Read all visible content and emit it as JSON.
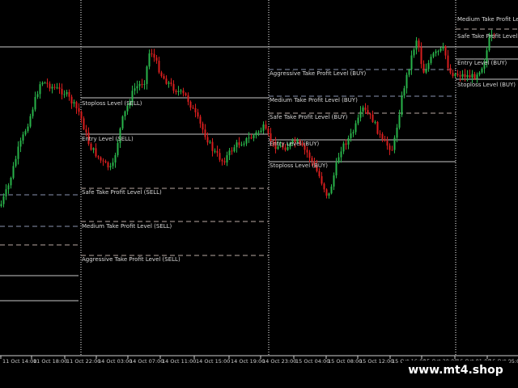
{
  "colors": {
    "background": "#000000",
    "bull_candle": "#29b34a",
    "bear_candle": "#d81e1e",
    "level_line": "#c8c8c8",
    "dashed_sell": "#b9a9a2",
    "dashed_buy": "#8a93b0",
    "period_separator": "#ffffff",
    "watermark_text": "#ffffff"
  },
  "levels_sell": [
    {
      "label": "Stoploss Level (SELL)"
    },
    {
      "label": "Entry Level (SELL)"
    },
    {
      "label": "Safe Take Profit Level (SELL)"
    },
    {
      "label": "Medium Take Profit Level (SELL)"
    },
    {
      "label": "Aggressive Take Profit Level (SELL)"
    }
  ],
  "levels_buy_1": [
    {
      "label": "Aggressive Take Profit Level (BUY)"
    },
    {
      "label": "Medium Take Profit Level (BUY)"
    },
    {
      "label": "Safe Take Profit Level (BUY)"
    },
    {
      "label": "Entry Level (BUY)"
    },
    {
      "label": "Stoploss Level (BUY)"
    }
  ],
  "levels_buy_2": [
    {
      "label": "Medium Take Profit Level (BUY)"
    },
    {
      "label": "Safe Take Profit Level (B"
    },
    {
      "label": "Entry Level (BUY)"
    },
    {
      "label": "Stoploss Level (BUY)"
    }
  ],
  "time_axis": [
    "11 Oct 14:00",
    "11 Oct 18:00",
    "11 Oct 22:00",
    "14 Oct 03:00",
    "14 Oct 07:00",
    "14 Oct 11:00",
    "14 Oct 15:00",
    "14 Oct 19:00",
    "14 Oct 23:00",
    "15 Oct 04:00",
    "15 Oct 08:00",
    "15 Oct 12:00",
    "15 Oct 16:00",
    "15 Oct 20:00",
    "16 Oct 01:00",
    "16 Oct 05:00"
  ],
  "watermark": "www.mt4.shop"
}
